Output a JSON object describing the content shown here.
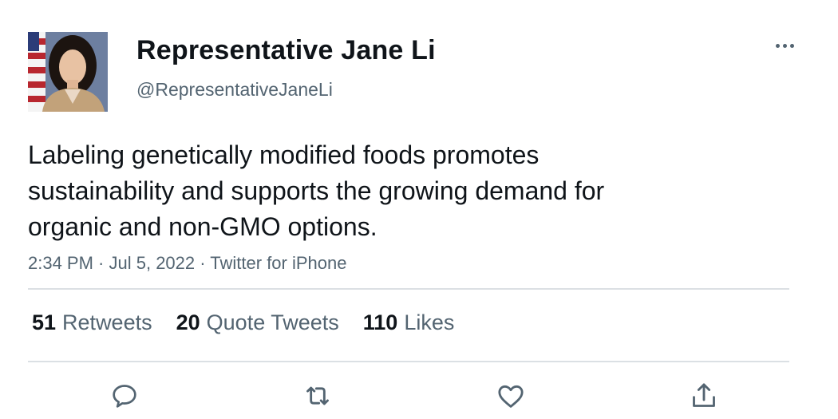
{
  "author": {
    "display_name": "Representative Jane Li",
    "handle": "@RepresentativeJaneLi"
  },
  "tweet": {
    "text_lines": [
      "Labeling genetically modified foods promotes",
      "sustainability and supports the growing demand for",
      "organic and non-GMO options."
    ],
    "time": "2:34 PM",
    "date": "Jul 5, 2022",
    "source": "Twitter for iPhone",
    "separator": " · "
  },
  "stats": {
    "retweets": {
      "count": "51",
      "label": "Retweets"
    },
    "quote_tweets": {
      "count": "20",
      "label": "Quote Tweets"
    },
    "likes": {
      "count": "110",
      "label": "Likes"
    }
  },
  "icons": {
    "more": "more-horizontal-icon",
    "reply": "reply-icon",
    "retweet": "retweet-icon",
    "like": "heart-icon",
    "share": "share-icon"
  },
  "colors": {
    "text_primary": "#0f1419",
    "text_secondary": "#536471",
    "divider": "#dbe0e4"
  }
}
